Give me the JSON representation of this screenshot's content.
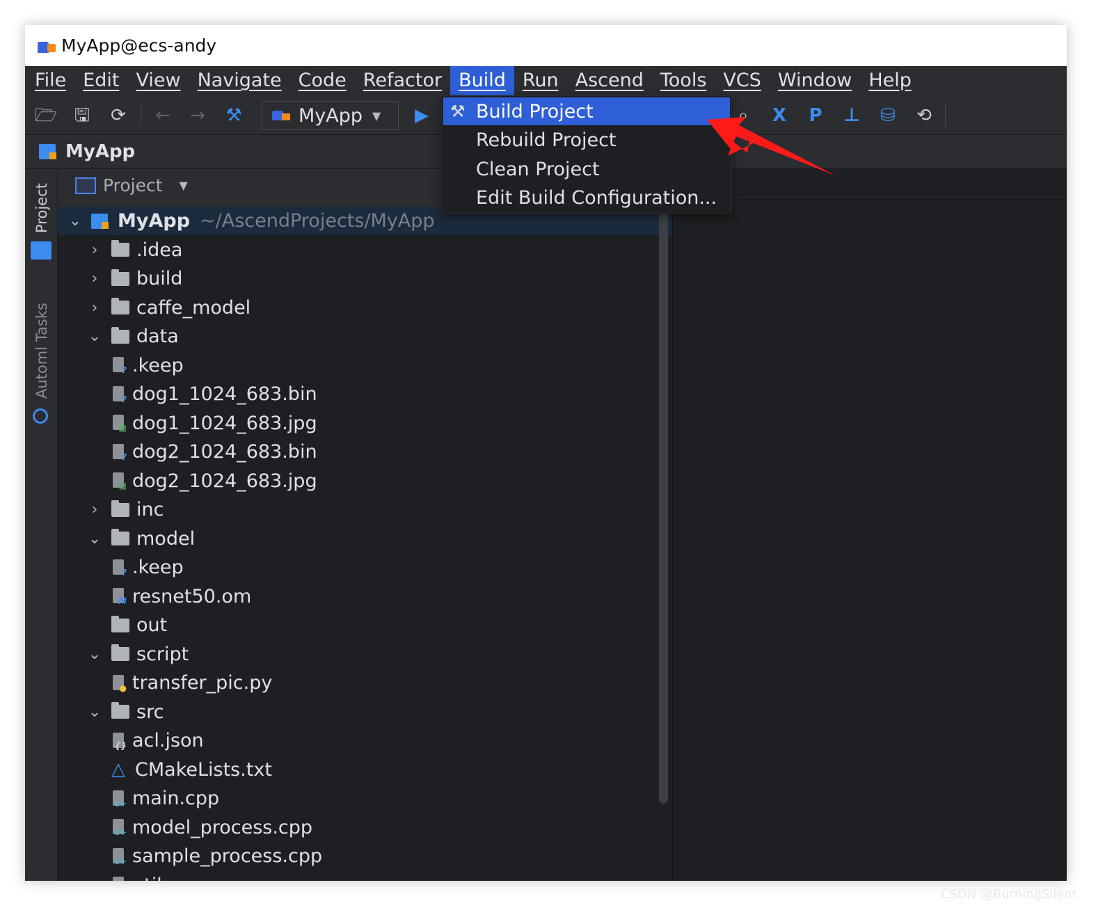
{
  "window": {
    "title": "MyApp@ecs-andy"
  },
  "menubar": {
    "items": [
      {
        "label": "File"
      },
      {
        "label": "Edit"
      },
      {
        "label": "View"
      },
      {
        "label": "Navigate"
      },
      {
        "label": "Code"
      },
      {
        "label": "Refactor"
      },
      {
        "label": "Build",
        "active": true
      },
      {
        "label": "Run"
      },
      {
        "label": "Ascend"
      },
      {
        "label": "Tools"
      },
      {
        "label": "VCS"
      },
      {
        "label": "Window"
      },
      {
        "label": "Help"
      }
    ]
  },
  "toolbar": {
    "run_config": "MyApp",
    "icons": [
      "open-folder-icon",
      "save-icon",
      "sync-icon",
      "back-arrow-icon",
      "forward-arrow-icon",
      "hammer-icon",
      "run-icon",
      "search-icon",
      "x-icon",
      "p-icon",
      "tree-icon",
      "model-icon",
      "refresh-icon"
    ]
  },
  "breadcrumb": {
    "project": "MyApp"
  },
  "leftstrip": {
    "project_label": "Project",
    "tasks_label": "Automl Tasks"
  },
  "project_panel": {
    "title": "Project",
    "root": {
      "name": "MyApp",
      "path": "~/AscendProjects/MyApp"
    },
    "rows": [
      {
        "name": ".idea",
        "type": "folder",
        "state": "collapsed",
        "depth": 1
      },
      {
        "name": "build",
        "type": "folder",
        "state": "collapsed",
        "depth": 1
      },
      {
        "name": "caffe_model",
        "type": "folder",
        "state": "collapsed",
        "depth": 1
      },
      {
        "name": "data",
        "type": "folder",
        "state": "expanded",
        "depth": 1
      },
      {
        "name": ".keep",
        "type": "unknown",
        "depth": 2
      },
      {
        "name": "dog1_1024_683.bin",
        "type": "unknown",
        "depth": 2
      },
      {
        "name": "dog1_1024_683.jpg",
        "type": "image",
        "depth": 2
      },
      {
        "name": "dog2_1024_683.bin",
        "type": "unknown",
        "depth": 2
      },
      {
        "name": "dog2_1024_683.jpg",
        "type": "image",
        "depth": 2
      },
      {
        "name": "inc",
        "type": "folder",
        "state": "collapsed",
        "depth": 1
      },
      {
        "name": "model",
        "type": "folder",
        "state": "expanded",
        "depth": 1
      },
      {
        "name": ".keep",
        "type": "unknown",
        "depth": 2
      },
      {
        "name": "resnet50.om",
        "type": "om",
        "depth": 2
      },
      {
        "name": "out",
        "type": "folder",
        "state": "none",
        "depth": 1
      },
      {
        "name": "script",
        "type": "folder",
        "state": "expanded",
        "depth": 1
      },
      {
        "name": "transfer_pic.py",
        "type": "python",
        "depth": 2
      },
      {
        "name": "src",
        "type": "folder",
        "state": "expanded",
        "depth": 1
      },
      {
        "name": "acl.json",
        "type": "json",
        "depth": 2
      },
      {
        "name": "CMakeLists.txt",
        "type": "cmake",
        "depth": 2
      },
      {
        "name": "main.cpp",
        "type": "cpp",
        "depth": 2
      },
      {
        "name": "model_process.cpp",
        "type": "cpp",
        "depth": 2
      },
      {
        "name": "sample_process.cpp",
        "type": "cpp",
        "depth": 2
      },
      {
        "name": "utils.cpp",
        "type": "cpp",
        "depth": 2
      }
    ]
  },
  "build_menu": {
    "items": [
      {
        "label": "Build Project",
        "highlighted": true
      },
      {
        "label": "Rebuild Project"
      },
      {
        "label": "Clean Project"
      },
      {
        "label": "Edit Build Configuration..."
      }
    ]
  },
  "watermark": "CSDN @BurningSilent",
  "colors": {
    "accent": "#2f5fd6",
    "background": "#1e1f22",
    "panel": "#2b2d30",
    "annotation_arrow": "#ff1a1a"
  }
}
